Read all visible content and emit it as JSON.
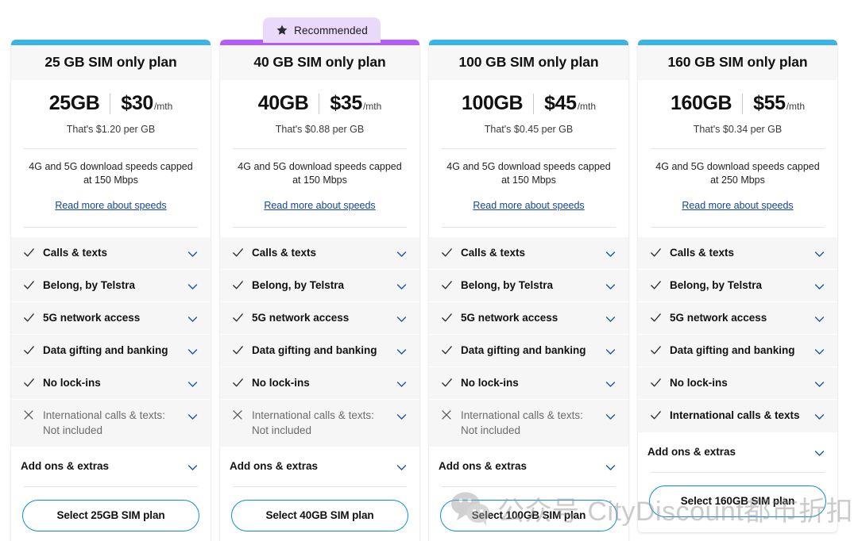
{
  "badge": {
    "label": "Recommended",
    "icon": "star-icon",
    "background": "#ead9fb"
  },
  "colors": {
    "accent_blue": "#3bb3e5",
    "accent_purple": "#b45cfa",
    "link_blue": "#12459e",
    "chevron_blue": "#1a56a8",
    "button_border": "#0b8de0"
  },
  "watermark": {
    "text": "公众号  CityDiscount都市折扣",
    "icon": "wechat-icon"
  },
  "cards": [
    {
      "accent": "#3bb3e5",
      "title": "25 GB SIM only plan",
      "data_amount": "25GB",
      "price": "$30",
      "price_period": "/mth",
      "per_gb": "That's $1.20 per GB",
      "speed_text": "4G and 5G download speeds capped at 150 Mbps",
      "speed_link": "Read more about speeds",
      "features": [
        {
          "label": "Calls & texts",
          "icon": "check-icon",
          "included": true
        },
        {
          "label": "Belong, by Telstra",
          "icon": "check-icon",
          "included": true
        },
        {
          "label": "5G network access",
          "icon": "check-icon",
          "included": true
        },
        {
          "label": "Data gifting and banking",
          "icon": "check-icon",
          "included": true
        },
        {
          "label": "No lock-ins",
          "icon": "check-icon",
          "included": true
        },
        {
          "label": "International calls & texts: Not included",
          "icon": "cross-icon",
          "included": false
        }
      ],
      "addons_label": "Add ons & extras",
      "select_label": "Select 25GB SIM plan"
    },
    {
      "accent": "#b45cfa",
      "recommended": true,
      "title": "40 GB SIM only plan",
      "data_amount": "40GB",
      "price": "$35",
      "price_period": "/mth",
      "per_gb": "That's $0.88 per GB",
      "speed_text": "4G and 5G download speeds capped at 150 Mbps",
      "speed_link": "Read more about speeds",
      "features": [
        {
          "label": "Calls & texts",
          "icon": "check-icon",
          "included": true
        },
        {
          "label": "Belong, by Telstra",
          "icon": "check-icon",
          "included": true
        },
        {
          "label": "5G network access",
          "icon": "check-icon",
          "included": true
        },
        {
          "label": "Data gifting and banking",
          "icon": "check-icon",
          "included": true
        },
        {
          "label": "No lock-ins",
          "icon": "check-icon",
          "included": true
        },
        {
          "label": "International calls & texts: Not included",
          "icon": "cross-icon",
          "included": false
        }
      ],
      "addons_label": "Add ons & extras",
      "select_label": "Select 40GB SIM plan"
    },
    {
      "accent": "#3bb3e5",
      "title": "100 GB SIM only plan",
      "data_amount": "100GB",
      "price": "$45",
      "price_period": "/mth",
      "per_gb": "That's $0.45 per GB",
      "speed_text": "4G and 5G download speeds capped at 150 Mbps",
      "speed_link": "Read more about speeds",
      "features": [
        {
          "label": "Calls & texts",
          "icon": "check-icon",
          "included": true
        },
        {
          "label": "Belong, by Telstra",
          "icon": "check-icon",
          "included": true
        },
        {
          "label": "5G network access",
          "icon": "check-icon",
          "included": true
        },
        {
          "label": "Data gifting and banking",
          "icon": "check-icon",
          "included": true
        },
        {
          "label": "No lock-ins",
          "icon": "check-icon",
          "included": true
        },
        {
          "label": "International calls & texts: Not included",
          "icon": "cross-icon",
          "included": false
        }
      ],
      "addons_label": "Add ons & extras",
      "select_label": "Select 100GB SIM plan"
    },
    {
      "accent": "#3bb3e5",
      "title": "160 GB SIM only plan",
      "data_amount": "160GB",
      "price": "$55",
      "price_period": "/mth",
      "per_gb": "That's $0.34 per GB",
      "speed_text": "4G and 5G download speeds capped at 250 Mbps",
      "speed_link": "Read more about speeds",
      "features": [
        {
          "label": "Calls & texts",
          "icon": "check-icon",
          "included": true
        },
        {
          "label": "Belong, by Telstra",
          "icon": "check-icon",
          "included": true
        },
        {
          "label": "5G network access",
          "icon": "check-icon",
          "included": true
        },
        {
          "label": "Data gifting and banking",
          "icon": "check-icon",
          "included": true
        },
        {
          "label": "No lock-ins",
          "icon": "check-icon",
          "included": true
        },
        {
          "label": "International calls & texts",
          "icon": "check-icon",
          "included": true
        }
      ],
      "addons_label": "Add ons & extras",
      "select_label": "Select 160GB SIM plan"
    }
  ]
}
